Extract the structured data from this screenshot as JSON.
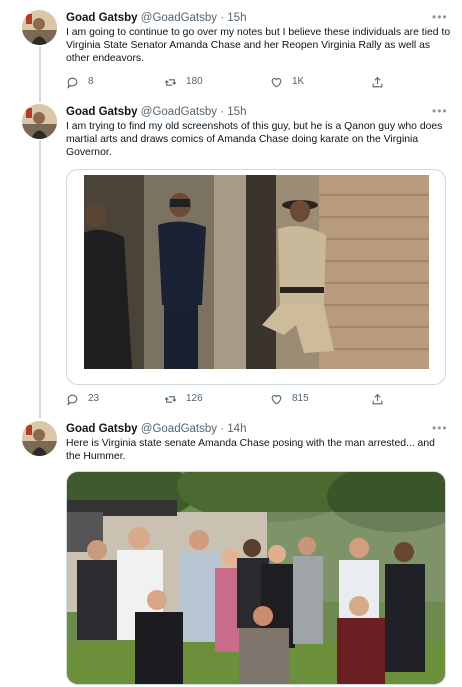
{
  "tweets": [
    {
      "name": "Goad Gatsby",
      "handle": "@GoadGatsby",
      "sep": "·",
      "time": "15h",
      "text": "I am going to continue to go over my notes but I believe these individuals are tied to Virginia State Senator Amanda Chase and her Reopen Virginia Rally as well as other endeavors.",
      "replies": "8",
      "retweets": "180",
      "likes": "1K"
    },
    {
      "name": "Goad Gatsby",
      "handle": "@GoadGatsby",
      "sep": "·",
      "time": "15h",
      "text": "I am trying to find my old screenshots of this guy, but he is a Qanon guy who does martial arts and draws comics of Amanda Chase doing karate on the Virginia Governor.",
      "replies": "23",
      "retweets": "126",
      "likes": "815"
    },
    {
      "name": "Goad Gatsby",
      "handle": "@GoadGatsby",
      "sep": "·",
      "time": "14h",
      "text": "Here is Virginia state senate Amanda Chase posing with the man arrested... and the Hummer."
    }
  ],
  "icons": {
    "reply": "reply-icon",
    "retweet": "retweet-icon",
    "like": "heart-icon",
    "share": "share-icon",
    "more": "more-icon"
  },
  "colors": {
    "text": "#0f1419",
    "secondary": "#536471",
    "border": "#cfd9de"
  }
}
